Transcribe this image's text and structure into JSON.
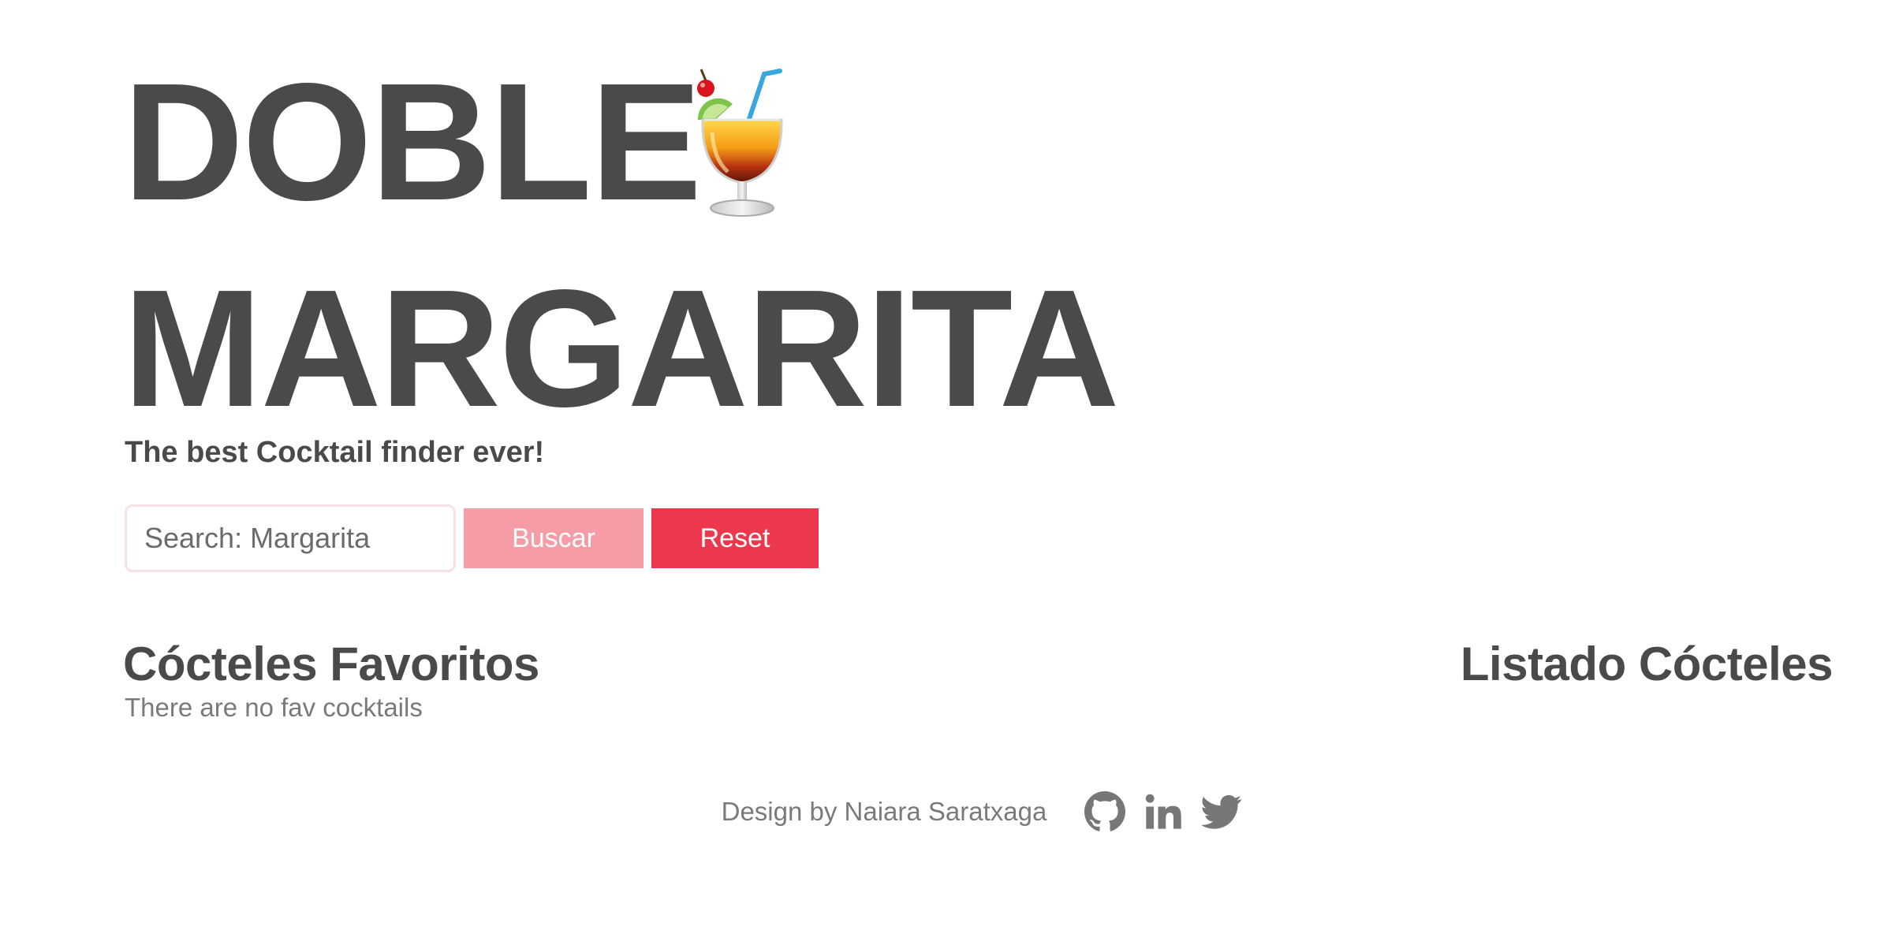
{
  "header": {
    "title_line_1": "DOBLE",
    "title_line_2": "MARGARITA",
    "title_emoji": "tropical-drink-icon",
    "subtitle": "The best Cocktail finder ever!"
  },
  "search": {
    "placeholder": "Search: Margarita",
    "value": "",
    "search_button_label": "Buscar",
    "reset_button_label": "Reset"
  },
  "favorites": {
    "title": "Cócteles Favoritos",
    "empty_message": "There are no fav cocktails"
  },
  "listing": {
    "title": "Listado Cócteles"
  },
  "footer": {
    "credit": "Design by Naiara Saratxaga",
    "social": [
      {
        "icon": "github-icon"
      },
      {
        "icon": "linkedin-icon"
      },
      {
        "icon": "twitter-icon"
      }
    ]
  },
  "colors": {
    "text_dark": "#4a4a4a",
    "text_muted": "#7a7a7a",
    "search_button": "#f69ca7",
    "reset_button": "#ec374d",
    "input_border": "#f8e1e4"
  }
}
